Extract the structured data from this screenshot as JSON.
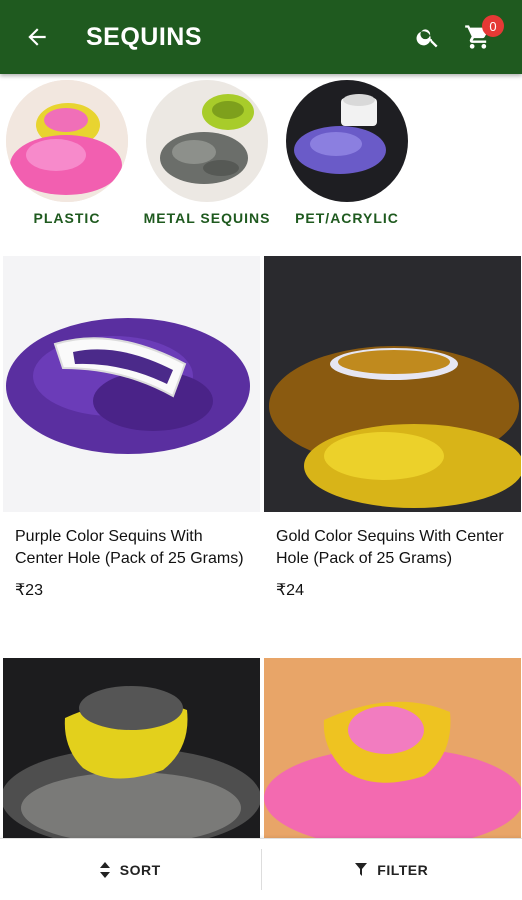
{
  "appbar": {
    "title": "SEQUINS",
    "cart_count": "0"
  },
  "categories": [
    {
      "label": "PLASTIC"
    },
    {
      "label": "METAL SEQUINS"
    },
    {
      "label": "PET/ACRYLIC"
    }
  ],
  "products": [
    {
      "title": "Purple Color Sequins With Center Hole (Pack of 25 Grams)",
      "price": "₹23"
    },
    {
      "title": "Gold Color Sequins With Center Hole (Pack of 25 Grams)",
      "price": "₹24"
    },
    {
      "title": "",
      "price": ""
    },
    {
      "title": "",
      "price": ""
    }
  ],
  "bottombar": {
    "sort_label": "SORT",
    "filter_label": "FILTER"
  },
  "colors": {
    "primary": "#1f5a1f",
    "badge": "#e53935"
  },
  "icons": [
    "arrow-left-icon",
    "search-icon",
    "cart-icon",
    "sort-icon",
    "filter-icon"
  ]
}
